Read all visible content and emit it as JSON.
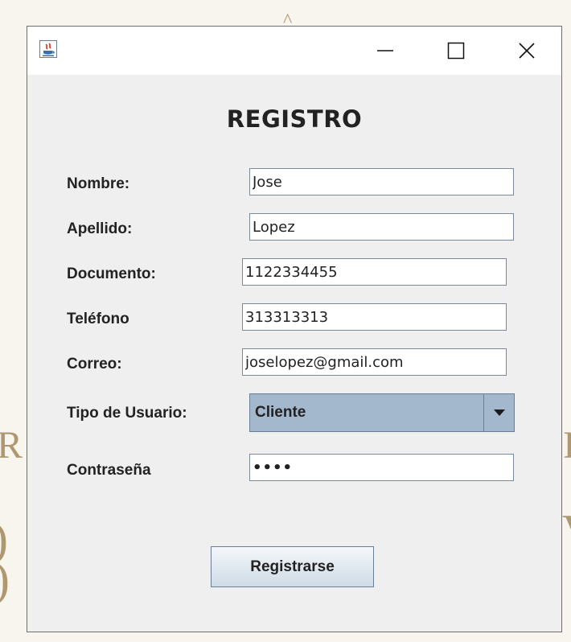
{
  "window": {
    "icon": "java-icon",
    "controls": [
      "minimize-icon",
      "maximize-icon",
      "close-icon"
    ]
  },
  "form": {
    "title": "REGISTRO",
    "fields": [
      {
        "label": "Nombre:",
        "value": "Jose"
      },
      {
        "label": "Apellido:",
        "value": "Lopez"
      },
      {
        "label": "Documento:",
        "value": "1122334455"
      },
      {
        "label": "Teléfono",
        "value": "313313313"
      },
      {
        "label": "Correo:",
        "value": "joselopez@gmail.com"
      }
    ],
    "user_type": {
      "label": "Tipo de Usuario:",
      "selected": "Cliente"
    },
    "password": {
      "label": "Contraseña",
      "value": "••••"
    },
    "submit_label": "Registrarse"
  },
  "colors": {
    "combo_fill": "#a3b8cc",
    "window_bg": "#efefef",
    "button_top": "#f4f7fa",
    "button_bottom": "#cfdbe6"
  }
}
